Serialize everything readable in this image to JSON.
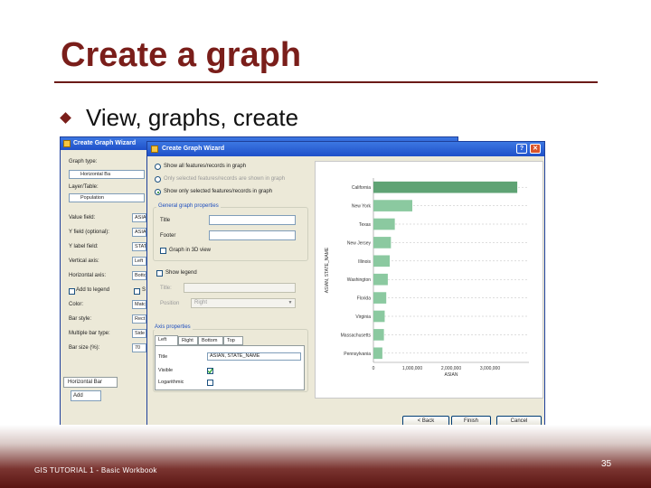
{
  "slide": {
    "title": "Create a graph",
    "bullet": "View, graphs, create",
    "footer": "GIS TUTORIAL 1 - Basic Workbook",
    "page_number": "35"
  },
  "back_window": {
    "title": "Create Graph Wizard",
    "graph_type_label": "Graph type:",
    "graph_type_value": "Horizontal Ba",
    "layer_table_label": "Layer/Table:",
    "layer_table_value": "Population",
    "fields": [
      {
        "label": "Value field:",
        "value": "ASIA"
      },
      {
        "label": "Y field (optional):",
        "value": "ASIA"
      },
      {
        "label": "Y label field:",
        "value": "STATE"
      },
      {
        "label": "Vertical axis:",
        "value": "Left"
      },
      {
        "label": "Horizontal axis:",
        "value": "Botto"
      },
      {
        "label": "Add to legend",
        "value": "S"
      },
      {
        "label": "Color:",
        "value": "Matc"
      },
      {
        "label": "Bar style:",
        "value": "Rect"
      },
      {
        "label": "Multiple bar type:",
        "value": "Side"
      },
      {
        "label": "Bar size (%):",
        "value": "70"
      }
    ],
    "tab_label": "Horizontal Bar",
    "add_button": "Add"
  },
  "front_window": {
    "title": "Create Graph Wizard",
    "help_glyph": "?",
    "close_glyph": "✕",
    "radio_options": [
      "Show all features/records in graph",
      "Only selected features/records are shown in graph",
      "Show only selected features/records in graph"
    ],
    "general_group": "General graph properties",
    "title_label": "Title",
    "footer_label": "Footer",
    "graph_3d_label": "Graph in 3D view",
    "legend_label": "Show legend",
    "legend_title_label": "Title:",
    "legend_position_label": "Position",
    "legend_position_value": "Right",
    "axis_group": "Axis properties",
    "axis_tabs": [
      "Left",
      "Right",
      "Bottom",
      "Top"
    ],
    "axis_props": [
      {
        "label": "Title",
        "value": "ASIAN, STATE_NAME"
      },
      {
        "label": "Visible",
        "checked": true
      },
      {
        "label": "Logarithmic",
        "checked": false
      }
    ],
    "buttons": {
      "back": "< Back",
      "finish": "Finish",
      "cancel": "Cancel"
    }
  },
  "chart_data": {
    "type": "bar",
    "orientation": "horizontal",
    "categories": [
      "California",
      "New York",
      "Texas",
      "New Jersey",
      "Illinois",
      "Washington",
      "Florida",
      "Virginia",
      "Massachusetts",
      "Pennsylvania"
    ],
    "values": [
      3700000,
      1000000,
      550000,
      450000,
      420000,
      370000,
      330000,
      290000,
      270000,
      230000
    ],
    "xlim": [
      0,
      4000000
    ],
    "xticks": [
      "0",
      "1,000,000",
      "2,000,000",
      "3,000,000"
    ],
    "ylabel": "ASIAN, STATE_NAME",
    "xlabel": "ASIAN",
    "colors": {
      "bar": "#8bc9a0",
      "first_bar": "#5fa374"
    }
  }
}
